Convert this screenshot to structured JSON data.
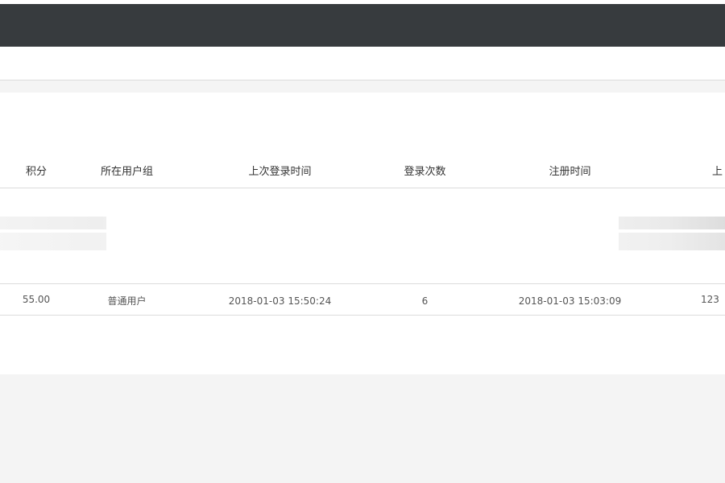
{
  "table": {
    "headers": {
      "points": "积分",
      "user_group": "所在用户组",
      "last_login_time": "上次登录时间",
      "login_count": "登录次数",
      "register_time": "注册时间",
      "last_partial": "上"
    },
    "row": {
      "points": "55.00",
      "user_group": "普通用户",
      "last_login_time": "2018-01-03 15:50:24",
      "login_count": "6",
      "register_time": "2018-01-03 15:03:09",
      "last_partial": "123"
    }
  }
}
